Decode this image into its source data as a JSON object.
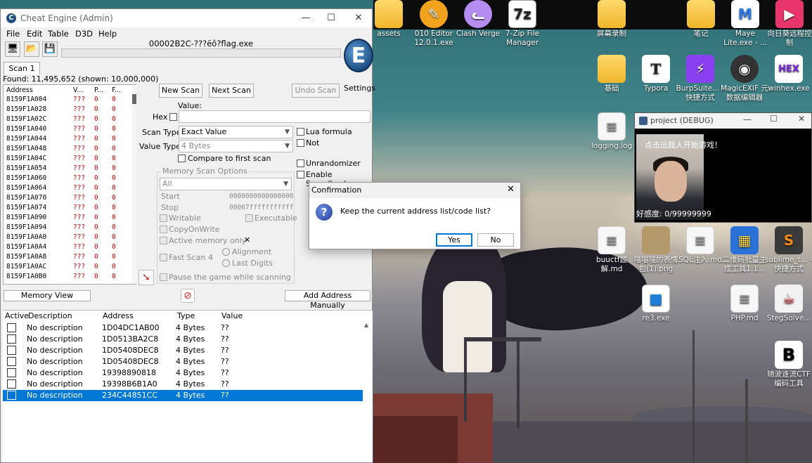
{
  "desktop": {
    "icons": [
      {
        "label": "assets",
        "icon": "folder-icon",
        "color": "#f0b62c"
      },
      {
        "label": "010 Editor 12.0.1.exe",
        "icon": "app-icon-010-editor",
        "color": "#f3a21b"
      },
      {
        "label": "Clash Verge",
        "icon": "cat-app-icon",
        "color": "#b58cf2"
      },
      {
        "label": "7-Zip File Manager",
        "icon": "7zip-icon",
        "color": "#222222"
      },
      {
        "label": "屏幕录制",
        "icon": "folder-icon",
        "color": "#f0b62c"
      },
      {
        "label": "笔记",
        "icon": "folder-icon",
        "color": "#f0b62c"
      },
      {
        "label": "Maye Lite.exe - ...",
        "icon": "maye-app-icon",
        "color": "#2a78e4"
      },
      {
        "label": "向日葵远程控制",
        "icon": "sunlogin-icon",
        "color": "#e8356b"
      },
      {
        "label": "基础",
        "icon": "folder-icon",
        "color": "#f0b62c"
      },
      {
        "label": "Typora",
        "icon": "typora-icon",
        "color": "#ffffff"
      },
      {
        "label": "BurpSuite... - 快捷方式",
        "icon": "burpsuite-icon",
        "color": "#8a3ff0"
      },
      {
        "label": "MagicEXIF 元数据编辑器",
        "icon": "magicexif-icon",
        "color": "#333333"
      },
      {
        "label": "winhex.exe",
        "icon": "winhex-icon",
        "color": "#7a2bd6"
      },
      {
        "label": "logging.log",
        "icon": "document-icon",
        "color": "#f7f7f7"
      },
      {
        "label": "buuctf题解.md",
        "icon": "document-icon",
        "color": "#f7f7f7"
      },
      {
        "label": "喵喵喵的表情包(1).png",
        "icon": "image-icon",
        "color": "#b49a6a"
      },
      {
        "label": "SQL注入.md",
        "icon": "document-icon",
        "color": "#f7f7f7"
      },
      {
        "label": "二维码批量生成工具1.1...",
        "icon": "qr-tool-icon",
        "color": "#2a72d8"
      },
      {
        "label": "sublime_t... - 快捷方式",
        "icon": "sublime-icon",
        "color": "#f28a18"
      },
      {
        "label": "re3.exe",
        "icon": "exe-icon",
        "color": "#1e7fd8"
      },
      {
        "label": "PHP.md",
        "icon": "document-icon",
        "color": "#f7f7f7"
      },
      {
        "label": "StegSolve...",
        "icon": "java-icon",
        "color": "#d03030"
      },
      {
        "label": "随波逐流CTF编码工具",
        "icon": "ctf-tool-icon",
        "color": "#ffffff"
      }
    ]
  },
  "ce": {
    "title": "Cheat Engine (Admin)",
    "menu": [
      "File",
      "Edit",
      "Table",
      "D3D",
      "Help"
    ],
    "process_name": "00002B2C-???ëô?flag.exe",
    "settings_label": "Settings",
    "logo_text": "E",
    "scan_tab": "Scan 1",
    "found_text": "Found: 11,495,652 (shown: 10,000,000)",
    "list_headers": {
      "address": "Address",
      "value": "V...",
      "prev": "P...",
      "first": "F..."
    },
    "list_rows": [
      {
        "address": "8159F1A004",
        "value": "???",
        "prev": "0",
        "first": "0"
      },
      {
        "address": "8159F1A028",
        "value": "???",
        "prev": "0",
        "first": "0"
      },
      {
        "address": "8159F1A02C",
        "value": "???",
        "prev": "0",
        "first": "0"
      },
      {
        "address": "8159F1A040",
        "value": "???",
        "prev": "0",
        "first": "0"
      },
      {
        "address": "8159F1A044",
        "value": "???",
        "prev": "0",
        "first": "0"
      },
      {
        "address": "8159F1A048",
        "value": "???",
        "prev": "0",
        "first": "0"
      },
      {
        "address": "8159F1A04C",
        "value": "???",
        "prev": "0",
        "first": "0"
      },
      {
        "address": "8159F1A054",
        "value": "???",
        "prev": "0",
        "first": "0"
      },
      {
        "address": "8159F1A060",
        "value": "???",
        "prev": "0",
        "first": "0"
      },
      {
        "address": "8159F1A064",
        "value": "???",
        "prev": "0",
        "first": "0"
      },
      {
        "address": "8159F1A070",
        "value": "???",
        "prev": "0",
        "first": "0"
      },
      {
        "address": "8159F1A074",
        "value": "???",
        "prev": "0",
        "first": "0"
      },
      {
        "address": "8159F1A090",
        "value": "???",
        "prev": "0",
        "first": "0"
      },
      {
        "address": "8159F1A094",
        "value": "???",
        "prev": "0",
        "first": "0"
      },
      {
        "address": "8159F1A0A0",
        "value": "???",
        "prev": "0",
        "first": "0"
      },
      {
        "address": "8159F1A0A4",
        "value": "???",
        "prev": "0",
        "first": "0"
      },
      {
        "address": "8159F1A0A8",
        "value": "???",
        "prev": "0",
        "first": "0"
      },
      {
        "address": "8159F1A0AC",
        "value": "???",
        "prev": "0",
        "first": "0"
      },
      {
        "address": "8159F1A0B0",
        "value": "???",
        "prev": "0",
        "first": "0"
      }
    ],
    "new_scan": "New Scan",
    "next_scan": "Next Scan",
    "undo_scan": "Undo Scan",
    "value_label": "Value:",
    "hex_label": "Hex",
    "scan_type_label": "Scan Type",
    "scan_type_value": "Exact Value",
    "value_type_label": "Value Type",
    "value_type_value": "4 Bytes",
    "compare_first": "Compare to first scan",
    "lua_formula": "Lua formula",
    "not_label": "Not",
    "unrandomizer": "Unrandomizer",
    "speedhack": "Enable Speedhack",
    "mem_options_title": "Memory Scan Options",
    "mem_region": "All",
    "start_label": "Start",
    "start_value": "0000000000000000",
    "stop_label": "Stop",
    "stop_value": "00007fffffffffff",
    "writable": "Writable",
    "executable": "Executable",
    "copyonwrite": "CopyOnWrite",
    "active_memory": "Active memory only",
    "active_memory_x": "✕",
    "fast_scan": "Fast Scan",
    "fast_scan_value": "4",
    "alignment": "Alignment",
    "last_digits": "Last Digits",
    "pause_game": "Pause the game while scanning",
    "memory_view": "Memory View",
    "add_address": "Add Address Manually",
    "table_headers": {
      "active": "Active",
      "description": "Description",
      "address": "Address",
      "type": "Type",
      "value": "Value"
    },
    "table_rows": [
      {
        "description": "No description",
        "address": "1D04DC1AB00",
        "type": "4 Bytes",
        "value": "??"
      },
      {
        "description": "No description",
        "address": "1D0513BA2C8",
        "type": "4 Bytes",
        "value": "??"
      },
      {
        "description": "No description",
        "address": "1D05408DEC8",
        "type": "4 Bytes",
        "value": "??"
      },
      {
        "description": "No description",
        "address": "1D05408DEC8",
        "type": "4 Bytes",
        "value": "??"
      },
      {
        "description": "No description",
        "address": "19398890818",
        "type": "4 Bytes",
        "value": "??"
      },
      {
        "description": "No description",
        "address": "19398B6B1A0",
        "type": "4 Bytes",
        "value": "??"
      },
      {
        "description": "No description",
        "address": "234C44851CC",
        "type": "4 Bytes",
        "value": "??",
        "selected": true
      }
    ]
  },
  "project": {
    "title": "project (DEBUG)",
    "start_text": "点击出题人开始游戏！",
    "affection": "好感度: 0/99999999"
  },
  "dialog": {
    "title": "Confirmation",
    "message": "Keep the current address list/code list?",
    "yes": "Yes",
    "no": "No"
  },
  "colors": {
    "accent": "#0078d7",
    "value_red": "#d10000",
    "desktop_sky": "#3f8388"
  }
}
